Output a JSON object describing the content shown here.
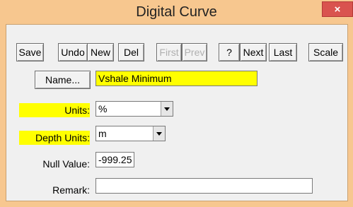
{
  "window": {
    "title": "Digital Curve",
    "close_glyph": "×"
  },
  "toolbar": {
    "save": "Save",
    "undo": "Undo",
    "new": "New",
    "del": "Del",
    "first": "First",
    "prev": "Prev",
    "help": "?",
    "next": "Next",
    "last": "Last",
    "scale": "Scale"
  },
  "form": {
    "name_button": "Name...",
    "name_value": "Vshale Minimum",
    "units_label": "Units:",
    "units_value": "%",
    "depth_units_label": "Depth Units:",
    "depth_units_value": "m",
    "null_label": "Null Value:",
    "null_value": "-999.25",
    "remark_label": "Remark:",
    "remark_value": ""
  },
  "colors": {
    "highlight": "#ffff00",
    "title_bar": "#f7c78f",
    "close": "#d9534f"
  }
}
